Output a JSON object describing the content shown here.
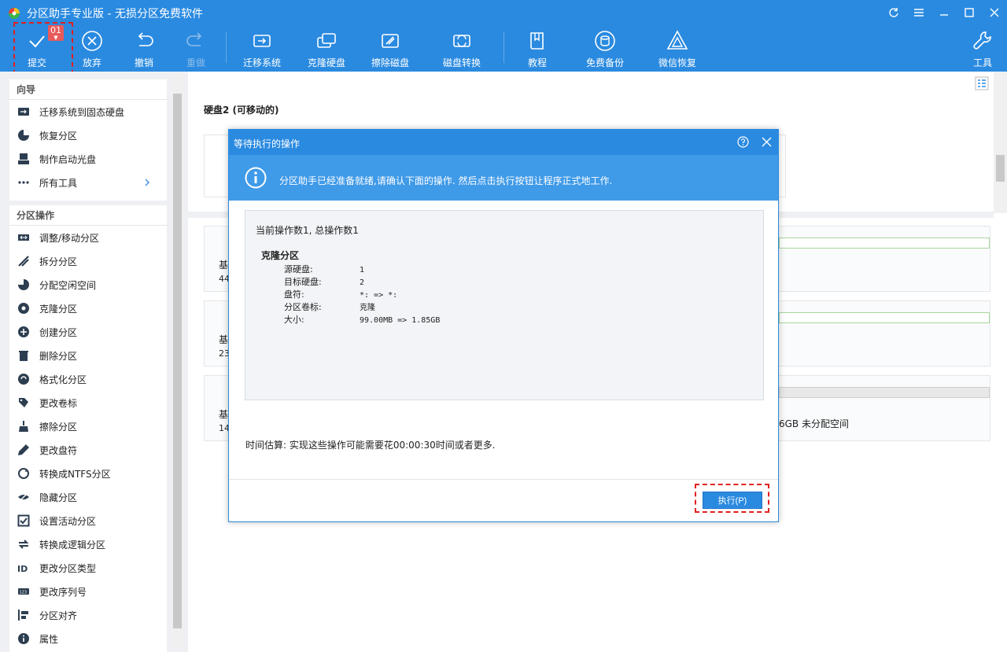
{
  "app": {
    "title": "分区助手专业版 - 无损分区免费软件"
  },
  "toolbar": {
    "submit": "提交",
    "submit_badge": "01",
    "discard": "放弃",
    "undo": "撤销",
    "redo": "重做",
    "migrate_os": "迁移系统",
    "clone_disk": "克隆硬盘",
    "wipe_disk": "擦除磁盘",
    "disk_convert": "磁盘转换",
    "tutorial": "教程",
    "free_backup": "免费备份",
    "wechat_recovery": "微信恢复",
    "tools": "工具"
  },
  "sidebar": {
    "wizard_title": "向导",
    "wizard_items": [
      {
        "label": "迁移系统到固态硬盘",
        "icon": "migrate-ssd-icon"
      },
      {
        "label": "恢复分区",
        "icon": "recover-partition-icon"
      },
      {
        "label": "制作启动光盘",
        "icon": "bootable-media-icon"
      },
      {
        "label": "所有工具",
        "icon": "more-dots-icon"
      }
    ],
    "ops_title": "分区操作",
    "ops_items": [
      {
        "label": "调整/移动分区",
        "icon": "resize-icon"
      },
      {
        "label": "拆分分区",
        "icon": "split-icon"
      },
      {
        "label": "分配空闲空间",
        "icon": "allocate-icon"
      },
      {
        "label": "克隆分区",
        "icon": "clone-partition-icon"
      },
      {
        "label": "创建分区",
        "icon": "create-partition-icon"
      },
      {
        "label": "删除分区",
        "icon": "delete-partition-icon"
      },
      {
        "label": "格式化分区",
        "icon": "format-icon"
      },
      {
        "label": "更改卷标",
        "icon": "label-icon"
      },
      {
        "label": "擦除分区",
        "icon": "wipe-partition-icon"
      },
      {
        "label": "更改盘符",
        "icon": "drive-letter-icon"
      },
      {
        "label": "转换成NTFS分区",
        "icon": "convert-ntfs-icon"
      },
      {
        "label": "隐藏分区",
        "icon": "hide-icon"
      },
      {
        "label": "设置活动分区",
        "icon": "set-active-icon"
      },
      {
        "label": "转换成逻辑分区",
        "icon": "convert-logical-icon"
      },
      {
        "label": "更改分区类型",
        "icon": "partition-type-icon"
      },
      {
        "label": "更改序列号",
        "icon": "serial-number-icon"
      },
      {
        "label": "分区对齐",
        "icon": "align-icon"
      },
      {
        "label": "属性",
        "icon": "info-icon"
      }
    ]
  },
  "main": {
    "disk_title": "硬盘2 (可移动的)",
    "cards": [
      {
        "label": "基",
        "sub": "44"
      },
      {
        "label": "基",
        "sub": "23"
      },
      {
        "label": "基",
        "sub": "14",
        "unalloc": "6GB 未分配空间"
      }
    ]
  },
  "modal": {
    "title": "等待执行的操作",
    "info": "分区助手已经准备就绪,请确认下面的操作. 然后点击执行按钮让程序正式地工作.",
    "op_count": "当前操作数1, 总操作数1",
    "op_title": "克隆分区",
    "op_rows": [
      {
        "k": "源硬盘:",
        "v": "1"
      },
      {
        "k": "目标硬盘:",
        "v": "2"
      },
      {
        "k": "盘符:",
        "v": "*: => *:"
      },
      {
        "k": "分区卷标:",
        "v": "克隆"
      },
      {
        "k": "大小:",
        "v": "99.00MB => 1.85GB"
      }
    ],
    "time_estimate": "时间估算: 实现这些操作可能需要花00:00:30时间或者更多.",
    "execute_button": "执行(P)"
  }
}
